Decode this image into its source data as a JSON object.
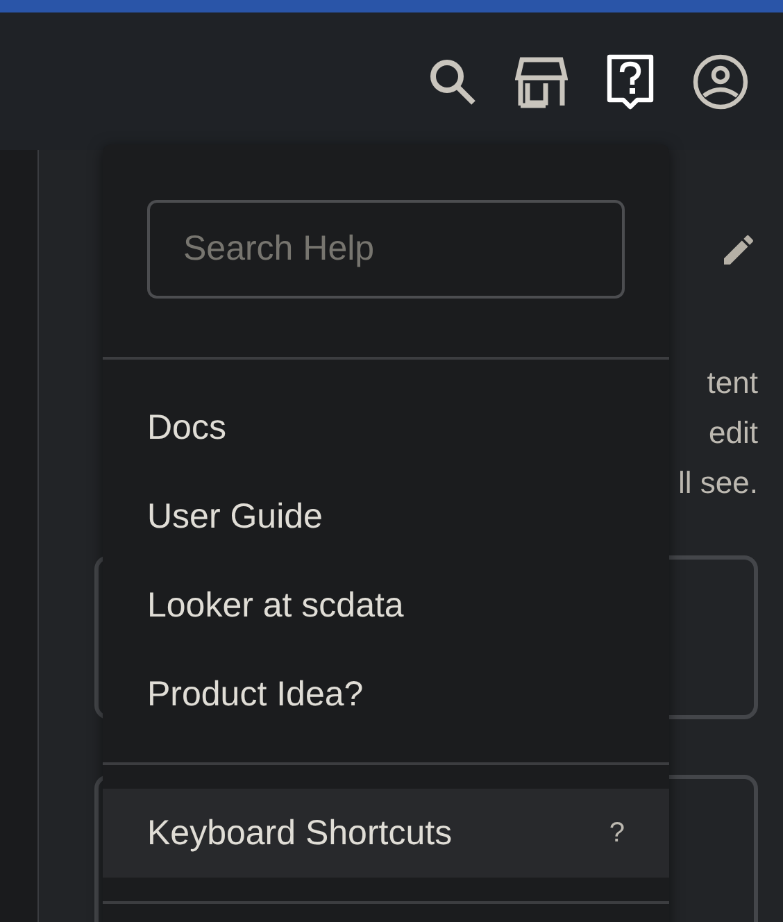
{
  "page": {
    "text_fragments": [
      "tent",
      "edit",
      "ll see."
    ]
  },
  "help_menu": {
    "search": {
      "placeholder": "Search Help"
    },
    "sections": [
      {
        "items": [
          {
            "label": "Docs",
            "highlighted": false
          },
          {
            "label": "User Guide",
            "highlighted": false
          },
          {
            "label": "Looker at scdata",
            "highlighted": false
          },
          {
            "label": "Product Idea?",
            "highlighted": false
          }
        ]
      },
      {
        "items": [
          {
            "label": "Keyboard Shortcuts",
            "shortcut": "?",
            "highlighted": true
          }
        ]
      }
    ]
  }
}
